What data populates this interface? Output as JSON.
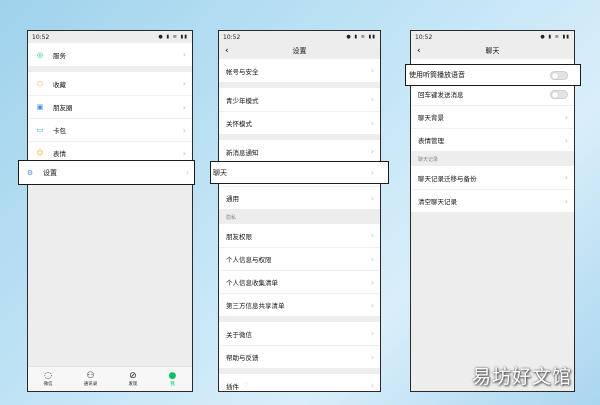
{
  "phone1": {
    "status_time": "10:52",
    "status_icons": "● ▮ ≋ ▮▮",
    "rows": [
      {
        "label": "服务",
        "icon": "service-icon"
      },
      {
        "label": "收藏",
        "icon": "favorites-icon"
      },
      {
        "label": "朋友圈",
        "icon": "moments-icon"
      },
      {
        "label": "卡包",
        "icon": "card-wallet-icon"
      },
      {
        "label": "表情",
        "icon": "sticker-icon"
      }
    ],
    "settings_label": "设置",
    "tabs": [
      {
        "label": "微信",
        "icon": "chat-bubble-icon"
      },
      {
        "label": "通讯录",
        "icon": "contacts-icon"
      },
      {
        "label": "发现",
        "icon": "compass-icon"
      },
      {
        "label": "我",
        "icon": "me-icon"
      }
    ]
  },
  "phone2": {
    "status_time": "10:52",
    "status_icons": "● ▮ ≋ ▮▮",
    "title": "设置",
    "group1": [
      "帐号与安全"
    ],
    "group2": [
      "青少年模式",
      "关怀模式"
    ],
    "group3": [
      "新消息通知"
    ],
    "chat_label": "聊天",
    "general_label": "通用",
    "privacy_section": "隐私",
    "privacy_rows": [
      "朋友权限",
      "个人信息与权限",
      "个人信息收集清单",
      "第三方信息共享清单"
    ],
    "group5": [
      "关于微信",
      "帮助与反馈"
    ],
    "plugins_label": "插件"
  },
  "phone3": {
    "status_time": "10:52",
    "status_icons": "● ▮ ≋ ▮▮",
    "title": "聊天",
    "earpiece_label": "使用听筒播放语音",
    "enter_send_label": "回车键发送消息",
    "rows1": [
      "聊天背景",
      "表情管理"
    ],
    "history_section": "聊天记录",
    "rows2": [
      "聊天记录迁移与备份",
      "清空聊天记录"
    ]
  },
  "watermark": "易坊好文馆",
  "colors": {
    "accent_green": "#07c160",
    "page_bg": "#ededed"
  }
}
